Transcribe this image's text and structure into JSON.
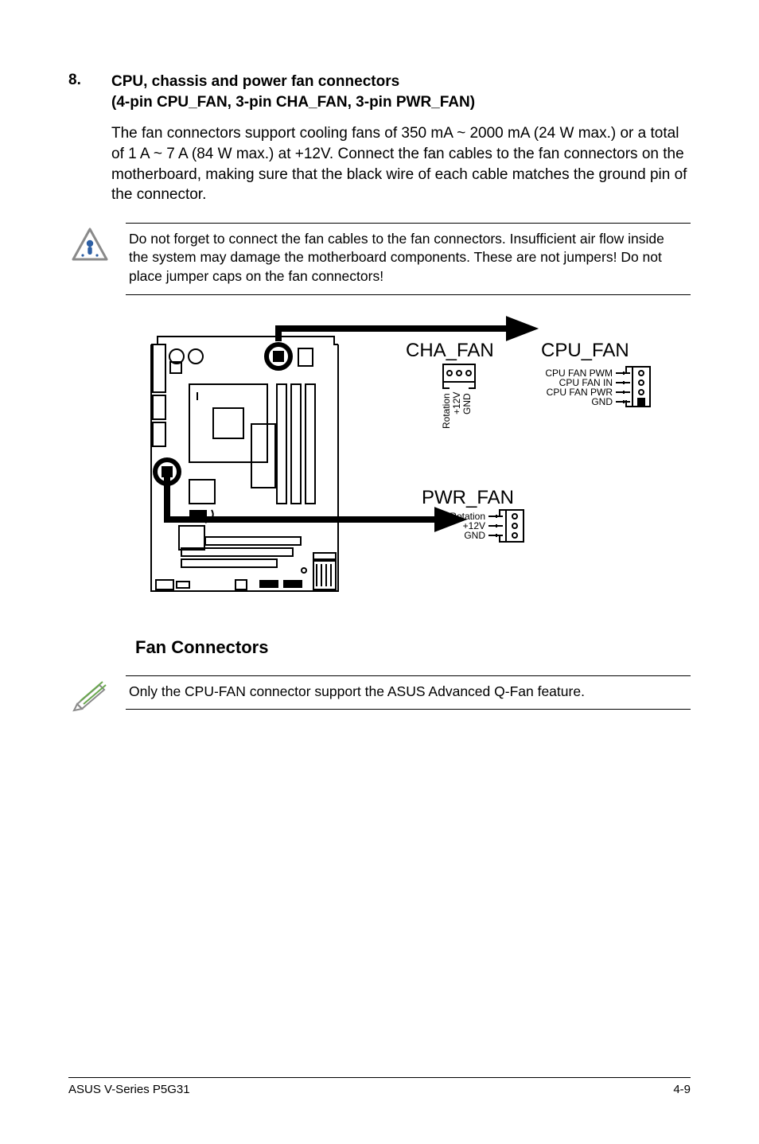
{
  "section": {
    "number": "8.",
    "title_line1": "CPU, chassis and power fan connectors",
    "title_line2": "(4-pin CPU_FAN, 3-pin CHA_FAN, 3-pin PWR_FAN)",
    "paragraph": "The fan connectors support cooling fans of 350 mA ~ 2000 mA (24 W max.) or a total of 1 A ~ 7 A (84 W max.) at +12V. Connect the fan cables to the fan connectors on the motherboard, making sure that the black wire of each cable matches the ground pin of the connector."
  },
  "warning": {
    "text": "Do not forget to connect the fan cables to the fan connectors. Insufficient air flow inside the system may damage the motherboard components. These are not jumpers! Do not place jumper caps on the fan connectors!"
  },
  "diagram": {
    "cha_fan": {
      "title": "CHA_FAN",
      "pins": [
        "Rotation",
        "+12V",
        "GND"
      ]
    },
    "cpu_fan": {
      "title": "CPU_FAN",
      "pins": [
        "CPU FAN PWM",
        "CPU FAN IN",
        "CPU FAN PWR",
        "GND"
      ]
    },
    "pwr_fan": {
      "title": "PWR_FAN",
      "pins": [
        "Rotation",
        "+12V",
        "GND"
      ]
    },
    "caption": "Fan Connectors"
  },
  "note": {
    "text": "Only the CPU-FAN connector support the ASUS Advanced Q-Fan feature."
  },
  "footer": {
    "left": "ASUS V-Series P5G31",
    "right": "4-9"
  }
}
